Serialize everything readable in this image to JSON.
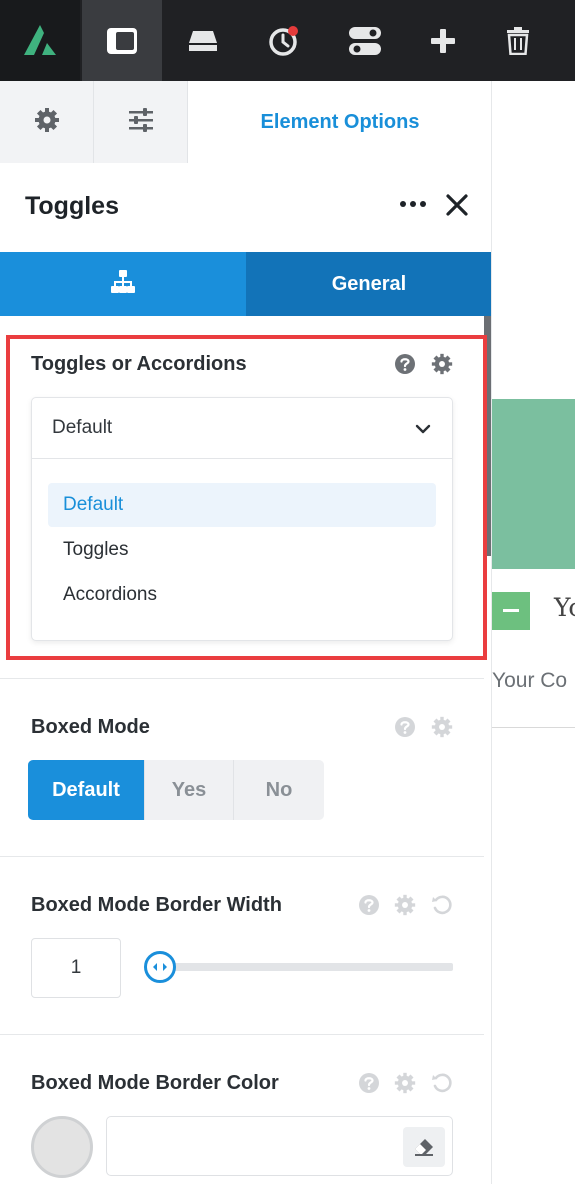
{
  "toolbar": {
    "icons": [
      "logo-icon",
      "panel-icon",
      "library-icon",
      "history-icon",
      "toggle-icon",
      "add-icon",
      "trash-icon"
    ],
    "colors": {
      "bg": "#202124",
      "logo_green": "#3fb27f",
      "notify": "#e53b3b"
    }
  },
  "sidebar": {
    "tabs": {
      "label": "Element Options"
    },
    "title": "Toggles",
    "seg_tabs": {
      "general": "General"
    },
    "option_toggles": {
      "label": "Toggles or Accordions",
      "value": "Default",
      "options": [
        "Default",
        "Toggles",
        "Accordions"
      ]
    },
    "boxed_mode": {
      "label": "Boxed Mode",
      "buttons": [
        "Default",
        "Yes",
        "No"
      ]
    },
    "border_width": {
      "label": "Boxed Mode Border Width",
      "value": "1",
      "slider_fraction": 0.0
    },
    "border_color": {
      "label": "Boxed Mode Border Color",
      "value": ""
    }
  },
  "preview": {
    "toggle_title": "Yo",
    "content": "Your Co"
  },
  "colors": {
    "accent": "#198fd9",
    "highlight": "#ea3d3f"
  }
}
